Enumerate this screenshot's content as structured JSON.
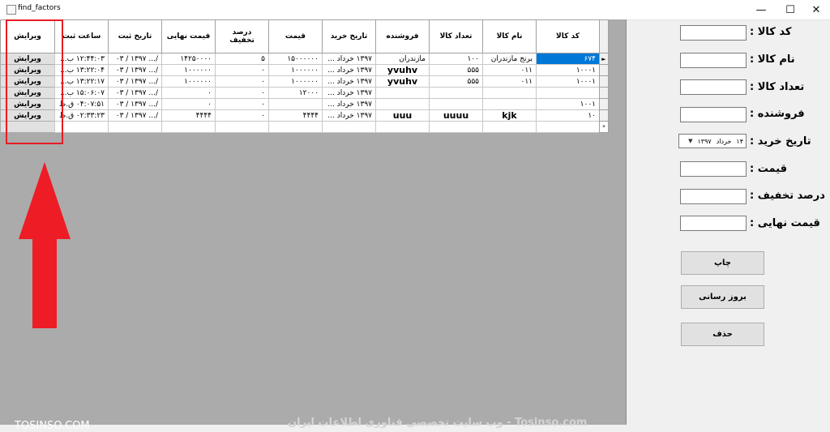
{
  "window": {
    "title": "find_factors",
    "minimize": "—",
    "maximize": "☐",
    "close": "✕"
  },
  "grid": {
    "columns": [
      "کد کالا",
      "نام کالا",
      "تعداد کالا",
      "فروشنده",
      "تاریخ خرید",
      "قیمت",
      "درصد تخفیف",
      "قیمت نهایی",
      "تاریخ ثبت",
      "ساعت ثبت",
      "ویرایش"
    ],
    "current_row_marker": "►",
    "new_row_marker": "*",
    "edit_label": "ویرایش",
    "rows": [
      [
        "۶۷۴",
        "برنج مازندران",
        "۱۰۰",
        "مازندران",
        "۱۳۹۷ خرداد ...",
        "۱۵۰۰۰۰۰۰",
        "۵",
        "۱۴۲۵۰۰۰۰",
        "/... ۱۳۹۷ / ۰۳",
        "۱۲:۴۴:۰۳ ب...",
        "ویرایش"
      ],
      [
        "۱۰۰۰۱",
        "۰۱۱",
        "۵۵۵",
        "yvuhv",
        "۱۳۹۷ خرداد ...",
        "۱۰۰۰۰۰۰",
        "۰",
        "۱۰۰۰۰۰۰",
        "/... ۱۳۹۷ / ۰۳",
        "۱۳:۲۲:۰۴ ب...",
        "ویرایش"
      ],
      [
        "۱۰۰۰۱",
        "۰۱۱",
        "۵۵۵",
        "yvuhv",
        "۱۳۹۷ خرداد ...",
        "۱۰۰۰۰۰۰",
        "۰",
        "۱۰۰۰۰۰۰",
        "/... ۱۳۹۷ / ۰۳",
        "۱۳:۲۲:۱۷ ب...",
        "ویرایش"
      ],
      [
        "",
        "",
        "",
        "",
        "۱۳۹۷ خرداد ...",
        "۱۲۰۰۰",
        "۰",
        "۰",
        "/... ۱۳۹۷ / ۰۳",
        "۱۵:۰۶:۰۷ ب...",
        "ویرایش"
      ],
      [
        "۱۰۰۱",
        "",
        "",
        "",
        "۱۳۹۷ خرداد ...",
        "",
        "۰",
        "۰",
        "/... ۱۳۹۷ / ۰۳",
        "۰۴:۰۷:۵۱ ق.ظ",
        "ویرایش"
      ],
      [
        "۱۰",
        "kjk",
        "uuuu",
        "uuu",
        "۱۳۹۷ خرداد ...",
        "۴۴۴۴",
        "۰",
        "۴۴۴۴",
        "/... ۱۳۹۷ / ۰۳",
        "۰۲:۳۳:۲۳ ق.ظ",
        "ویرایش"
      ]
    ]
  },
  "form": {
    "product_code_label": "کد کالا :",
    "product_name_label": "نام کالا :",
    "quantity_label": "تعداد کالا :",
    "seller_label": "فروشنده :",
    "purchase_date_label": "تاریخ خرید :",
    "price_label": "قیمت :",
    "discount_label": "درصد تخفیف :",
    "final_price_label": "قیمت نهایی :",
    "date_day": "۱۴",
    "date_month": "خرداد",
    "date_year": "۱۳۹۷",
    "print_button": "چاپ",
    "update_button": "بروز رسانی",
    "delete_button": "حذف"
  },
  "watermark": {
    "right_text": "Tosinso.com - وب سایت تخصصی فناوری اطلاعات ایران",
    "left_text": "TOSINSO.COM"
  },
  "colors": {
    "selection": "#0078d7",
    "highlight": "#e81c24",
    "grid_background": "#ababab"
  }
}
